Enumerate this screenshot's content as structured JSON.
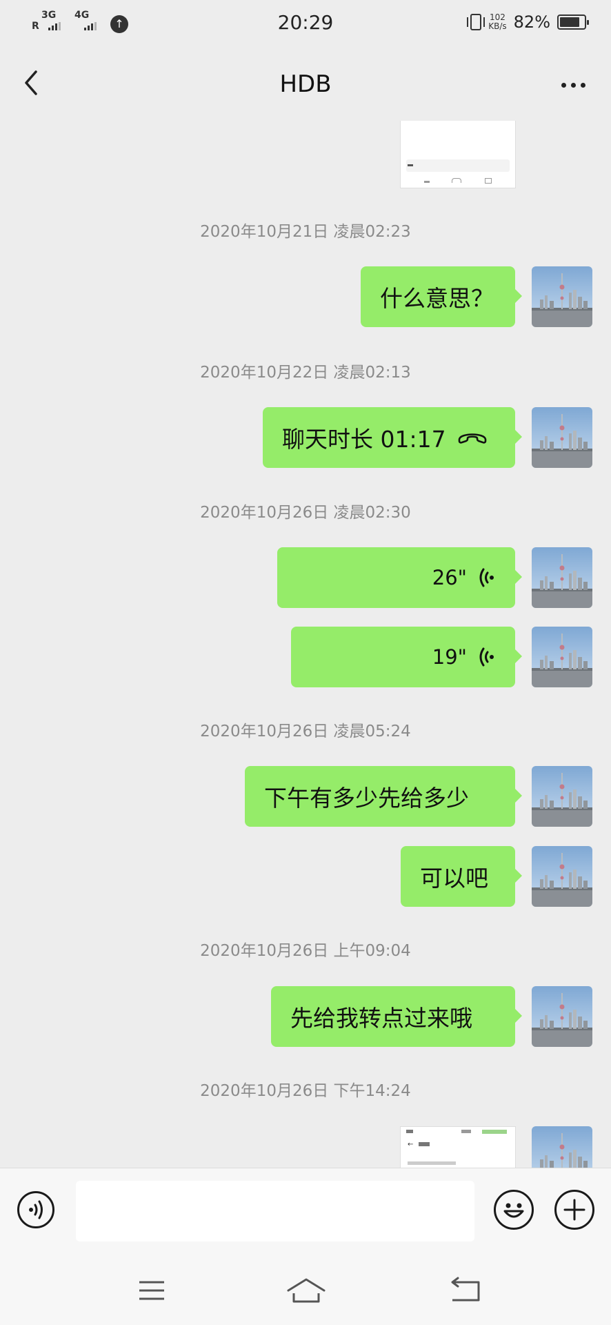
{
  "status_bar": {
    "time": "20:29",
    "net_1": "3G",
    "net_1_sub": "R",
    "net_2": "4G",
    "speed_value": "102",
    "speed_unit": "KB/s",
    "battery": "82%",
    "battery_level": 0.82
  },
  "header": {
    "title": "HDB"
  },
  "messages": [
    {
      "type": "timestamp",
      "text": "2020年10月21日 凌晨02:23"
    },
    {
      "type": "text",
      "text": "什么意思？"
    },
    {
      "type": "timestamp",
      "text": "2020年10月22日 凌晨02:13"
    },
    {
      "type": "call",
      "text": "聊天时长 01:17"
    },
    {
      "type": "timestamp",
      "text": "2020年10月26日 凌晨02:30"
    },
    {
      "type": "voice",
      "text": "26\""
    },
    {
      "type": "voice",
      "text": "19\""
    },
    {
      "type": "timestamp",
      "text": "2020年10月26日 凌晨05:24"
    },
    {
      "type": "text",
      "text": "下午有多少先给多少"
    },
    {
      "type": "text",
      "text": "可以吧"
    },
    {
      "type": "timestamp",
      "text": "2020年10月26日 上午09:04"
    },
    {
      "type": "text",
      "text": "先给我转点过来哦"
    },
    {
      "type": "timestamp",
      "text": "2020年10月26日 下午14:24"
    }
  ],
  "input": {
    "placeholder": "",
    "value": ""
  },
  "colors": {
    "bubble": "#95ec69",
    "background": "#ededed",
    "timestamp": "#8a8a8a"
  },
  "icons": [
    "back-arrow-icon",
    "more-dots-icon",
    "voice-wave-icon",
    "hangup-phone-icon",
    "voice-input-icon",
    "emoji-icon",
    "plus-icon",
    "menu-icon",
    "home-icon",
    "back-nav-icon"
  ]
}
